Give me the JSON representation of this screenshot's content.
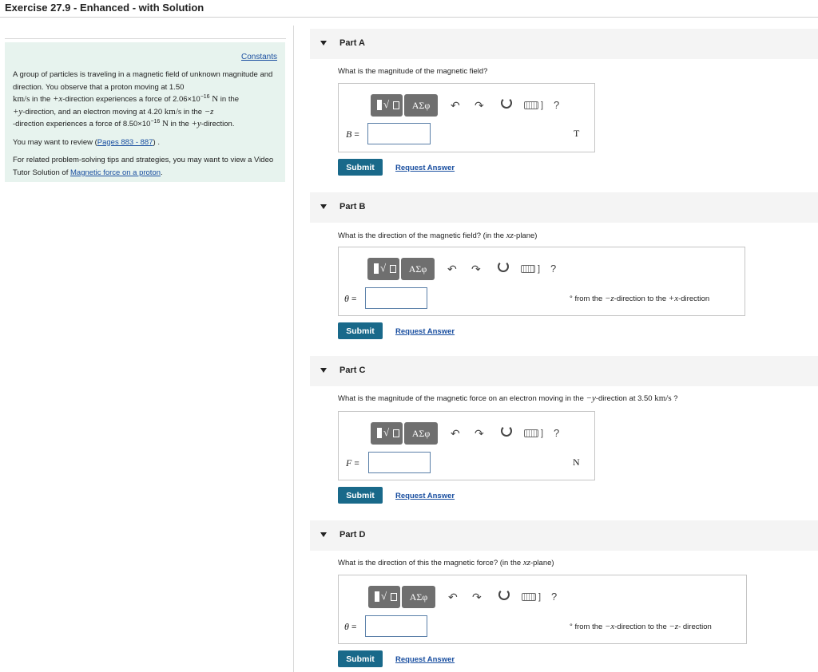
{
  "page": {
    "title": "Exercise 27.9 - Enhanced - with Solution"
  },
  "problem": {
    "constants_link": "Constants",
    "p1_a": "A group of particles is traveling in a magnetic field of unknown magnitude and direction. You observe that a proton moving at 1.50",
    "p1_unit1": "km/s",
    "p1_b": " in the ",
    "p1_dir1": "+x",
    "p1_c": "-direction experiences a force of 2.06×10",
    "p1_exp1": "−16",
    "p1_unit2": "N",
    "p1_d": " in the ",
    "p1_dir2": "+y",
    "p1_e": "-direction, and an electron moving at 4.20 ",
    "p1_unit3": "km/s",
    "p1_f": " in the ",
    "p1_dir3": "−z",
    "p1_g": "-direction experiences a force of 8.50×10",
    "p1_exp2": "−16",
    "p1_unit4": "N",
    "p1_h": " in the ",
    "p1_dir4": "+y",
    "p1_i": "-direction.",
    "p2_a": "You may want to review (",
    "p2_link": "Pages 883 - 887",
    "p2_b": ") .",
    "p3_a": "For related problem-solving tips and strategies, you may want to view a Video Tutor Solution of ",
    "p3_link": "Magnetic force on a proton",
    "p3_b": "."
  },
  "toolbar": {
    "greek_label": "ΑΣφ",
    "undo_icon": "↶",
    "redo_icon": "↷",
    "kbd_bracket": "]",
    "help_label": "?"
  },
  "parts": [
    {
      "label": "Part A",
      "question": "What is the magnitude of the magnetic field?",
      "variable": "B",
      "equals": " =",
      "unit": "T",
      "submit": "Submit",
      "request": "Request Answer"
    },
    {
      "label": "Part B",
      "question_a": "What is the direction of the magnetic field? (in the ",
      "question_plane": "xz",
      "question_b": "-plane)",
      "variable": "θ",
      "equals": " =",
      "unit_a": "° from the ",
      "unit_dir1": "−z",
      "unit_b": "-direction to the ",
      "unit_dir2": "+x",
      "unit_c": "-direction",
      "submit": "Submit",
      "request": "Request Answer"
    },
    {
      "label": "Part C",
      "question_a": "What is the magnitude of the magnetic force on an electron moving in the ",
      "question_dir": "−y",
      "question_b": "-direction at 3.50 ",
      "question_unit": "km/s",
      "question_c": " ?",
      "variable": "F",
      "equals": " =",
      "unit": "N",
      "submit": "Submit",
      "request": "Request Answer"
    },
    {
      "label": "Part D",
      "question_a": "What is the direction of this the magnetic force? (in the ",
      "question_plane": "xz",
      "question_b": "-plane)",
      "variable": "θ",
      "equals": " =",
      "unit_a": "° from the ",
      "unit_dir1": "−x",
      "unit_b": "-direction to the ",
      "unit_dir2": "−z",
      "unit_c": "- direction",
      "submit": "Submit",
      "request": "Request Answer"
    }
  ]
}
